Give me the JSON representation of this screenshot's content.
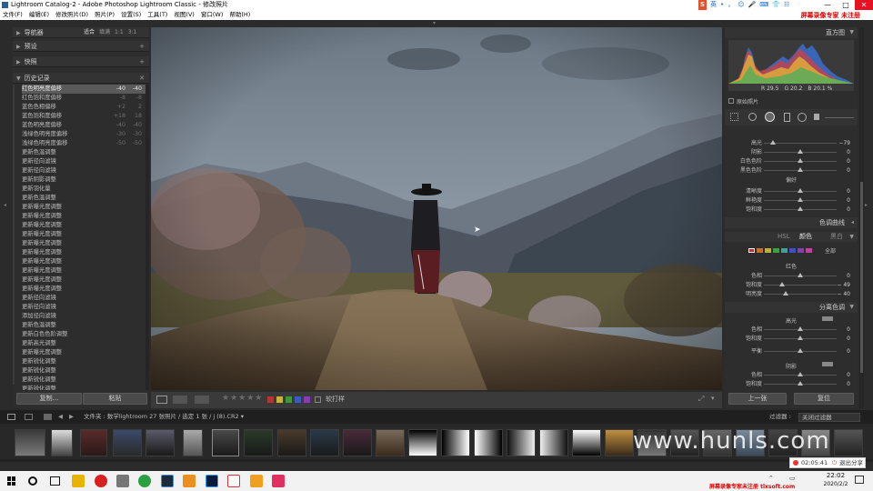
{
  "window": {
    "title": "Lightroom Catalog-2 - Adobe Photoshop Lightroom Classic - 修改照片",
    "controls": [
      "—",
      "□",
      "✕"
    ]
  },
  "ime": {
    "logo": "S",
    "items": [
      "英",
      "•",
      "，",
      "☺",
      "🎤",
      "⌨",
      "👕",
      "☷"
    ]
  },
  "watermark_top": "屏幕录像专家 未注册",
  "watermark_bottom": "屏幕录像专家未注册 tlxsoft.com",
  "watermark_site": "www.hunls.com",
  "menu": [
    "文件(F)",
    "编辑(E)",
    "修改照片(D)",
    "照片(P)",
    "设置(S)",
    "工具(T)",
    "视图(V)",
    "窗口(W)",
    "帮助(H)"
  ],
  "left_panel": {
    "navigator": {
      "label": "导航器",
      "options": [
        "适合",
        "填满",
        "1:1",
        "3:1"
      ]
    },
    "presets": {
      "label": "预设"
    },
    "snapshots": {
      "label": "快照"
    },
    "history": {
      "label": "历史记录",
      "rows": [
        {
          "name": "红色明亮度偏移",
          "v1": "-40",
          "v2": "-40",
          "selected": true
        },
        {
          "name": "红色饱和度偏移",
          "v1": "-8",
          "v2": "-8"
        },
        {
          "name": "蓝色色相偏移",
          "v1": "+2",
          "v2": "2"
        },
        {
          "name": "蓝色饱和度偏移",
          "v1": "+18",
          "v2": "18"
        },
        {
          "name": "蓝色明亮度偏移",
          "v1": "-40",
          "v2": "-40"
        },
        {
          "name": "浅绿色明亮度偏移",
          "v1": "-30",
          "v2": "-30"
        },
        {
          "name": "浅绿色明亮度偏移",
          "v1": "-50",
          "v2": "-50"
        },
        {
          "name": "更新色温调整"
        },
        {
          "name": "更新径向滤镜"
        },
        {
          "name": "更新径向滤镜"
        },
        {
          "name": "更新阴影调整"
        },
        {
          "name": "更新羽化量"
        },
        {
          "name": "更新色温调整"
        },
        {
          "name": "更新曝光度调整"
        },
        {
          "name": "更新曝光度调整"
        },
        {
          "name": "更新曝光度调整"
        },
        {
          "name": "更新曝光度调整"
        },
        {
          "name": "更新曝光度调整"
        },
        {
          "name": "更新曝光度调整"
        },
        {
          "name": "更新曝光度调整"
        },
        {
          "name": "更新曝光度调整"
        },
        {
          "name": "更新曝光度调整"
        },
        {
          "name": "更新曝光度调整"
        },
        {
          "name": "更新径向滤镜"
        },
        {
          "name": "更新径向滤镜"
        },
        {
          "name": "添加径向滤镜"
        },
        {
          "name": "更新色温调整"
        },
        {
          "name": "更新白色色阶调整"
        },
        {
          "name": "更新高光调整"
        },
        {
          "name": "更新曝光度调整"
        },
        {
          "name": "更新锐化调整"
        },
        {
          "name": "更新锐化调整"
        },
        {
          "name": "更新锐化调整"
        },
        {
          "name": "更新锐化调整"
        }
      ]
    },
    "buttons": {
      "copy": "复制...",
      "paste": "粘贴"
    }
  },
  "toolbar": {
    "soft_proof": "软打样"
  },
  "right_panel": {
    "histogram": {
      "label": "直方图",
      "readouts": [
        "R 29.5",
        "G 20.2",
        "B 20.1 %"
      ],
      "original_photo": "原始照片"
    },
    "tone": [
      {
        "label": "高光",
        "value": "−79",
        "pos": 0.12
      },
      {
        "label": "阴影",
        "value": "0",
        "pos": 0.5
      },
      {
        "label": "白色色阶",
        "value": "0",
        "pos": 0.5
      },
      {
        "label": "黑色色阶",
        "value": "0",
        "pos": 0.5
      }
    ],
    "presence": {
      "label": "偏好",
      "rows": [
        {
          "label": "清晰度",
          "value": "0",
          "pos": 0.5
        },
        {
          "label": "鲜艳度",
          "value": "0",
          "pos": 0.5
        },
        {
          "label": "饱和度",
          "value": "0",
          "pos": 0.5
        }
      ]
    },
    "tone_curve": "色调曲线",
    "hsl_tabs": [
      "HSL",
      "颜色",
      "黑白"
    ],
    "hsl_swatch_all": "全部",
    "hsl": {
      "label": "红色",
      "rows": [
        {
          "label": "色相",
          "value": "0",
          "pos": 0.5
        },
        {
          "label": "饱和度",
          "value": "− 49",
          "pos": 0.25
        },
        {
          "label": "明亮度",
          "value": "− 40",
          "pos": 0.3
        }
      ]
    },
    "split_toning": {
      "label": "分离色调",
      "highlight": "高光",
      "balance": "平衡",
      "shadow": "阴影",
      "rows_hi": [
        {
          "label": "色相",
          "value": "0"
        },
        {
          "label": "饱和度",
          "value": "0"
        }
      ],
      "rows_bal": [
        {
          "label": "平衡",
          "value": "0"
        }
      ],
      "rows_sh": [
        {
          "label": "色相",
          "value": "0"
        },
        {
          "label": "饱和度",
          "value": "0"
        }
      ]
    },
    "buttons": {
      "prev": "上一张",
      "reset": "复位"
    }
  },
  "filmstrip": {
    "path": "文件夹 : 数学lightroom   27 张照片 / 选定 1 张 / j (8).CR2 ▾",
    "filter_label": "过滤器 :",
    "filter_value": "关闭过滤器"
  },
  "taskbar": {
    "time": "22:02",
    "date": "2020/2/2",
    "recording": "02:05:41",
    "exit_share": "退出分享"
  }
}
